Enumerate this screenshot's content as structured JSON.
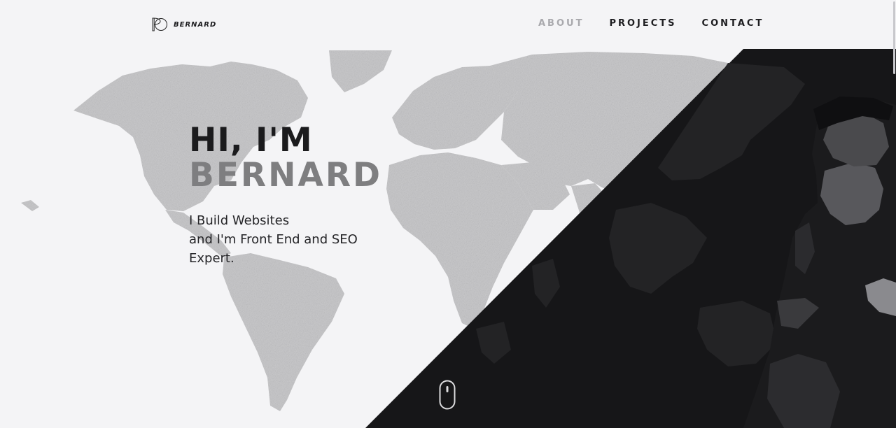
{
  "brand": {
    "name": "BERNARD",
    "logo_icon": "bd-monogram-icon"
  },
  "nav": {
    "items": [
      {
        "label": "ABOUT",
        "active": true
      },
      {
        "label": "PROJECTS",
        "active": false
      },
      {
        "label": "CONTACT",
        "active": false
      }
    ]
  },
  "hero": {
    "greeting": "HI, I'M",
    "name": "BERNARD",
    "subtitle_lines": [
      "I Build Websites",
      "and I'm Front End and SEO",
      "Expert."
    ]
  },
  "scroll_icon": "mouse-scroll-icon",
  "colors": {
    "background": "#f4f4f6",
    "dark_panel": "#161618",
    "map_light": "#c6c6c8",
    "map_dark": "#232325",
    "nav_active": "#a9a9ad",
    "name_gray": "#7e7e80"
  }
}
